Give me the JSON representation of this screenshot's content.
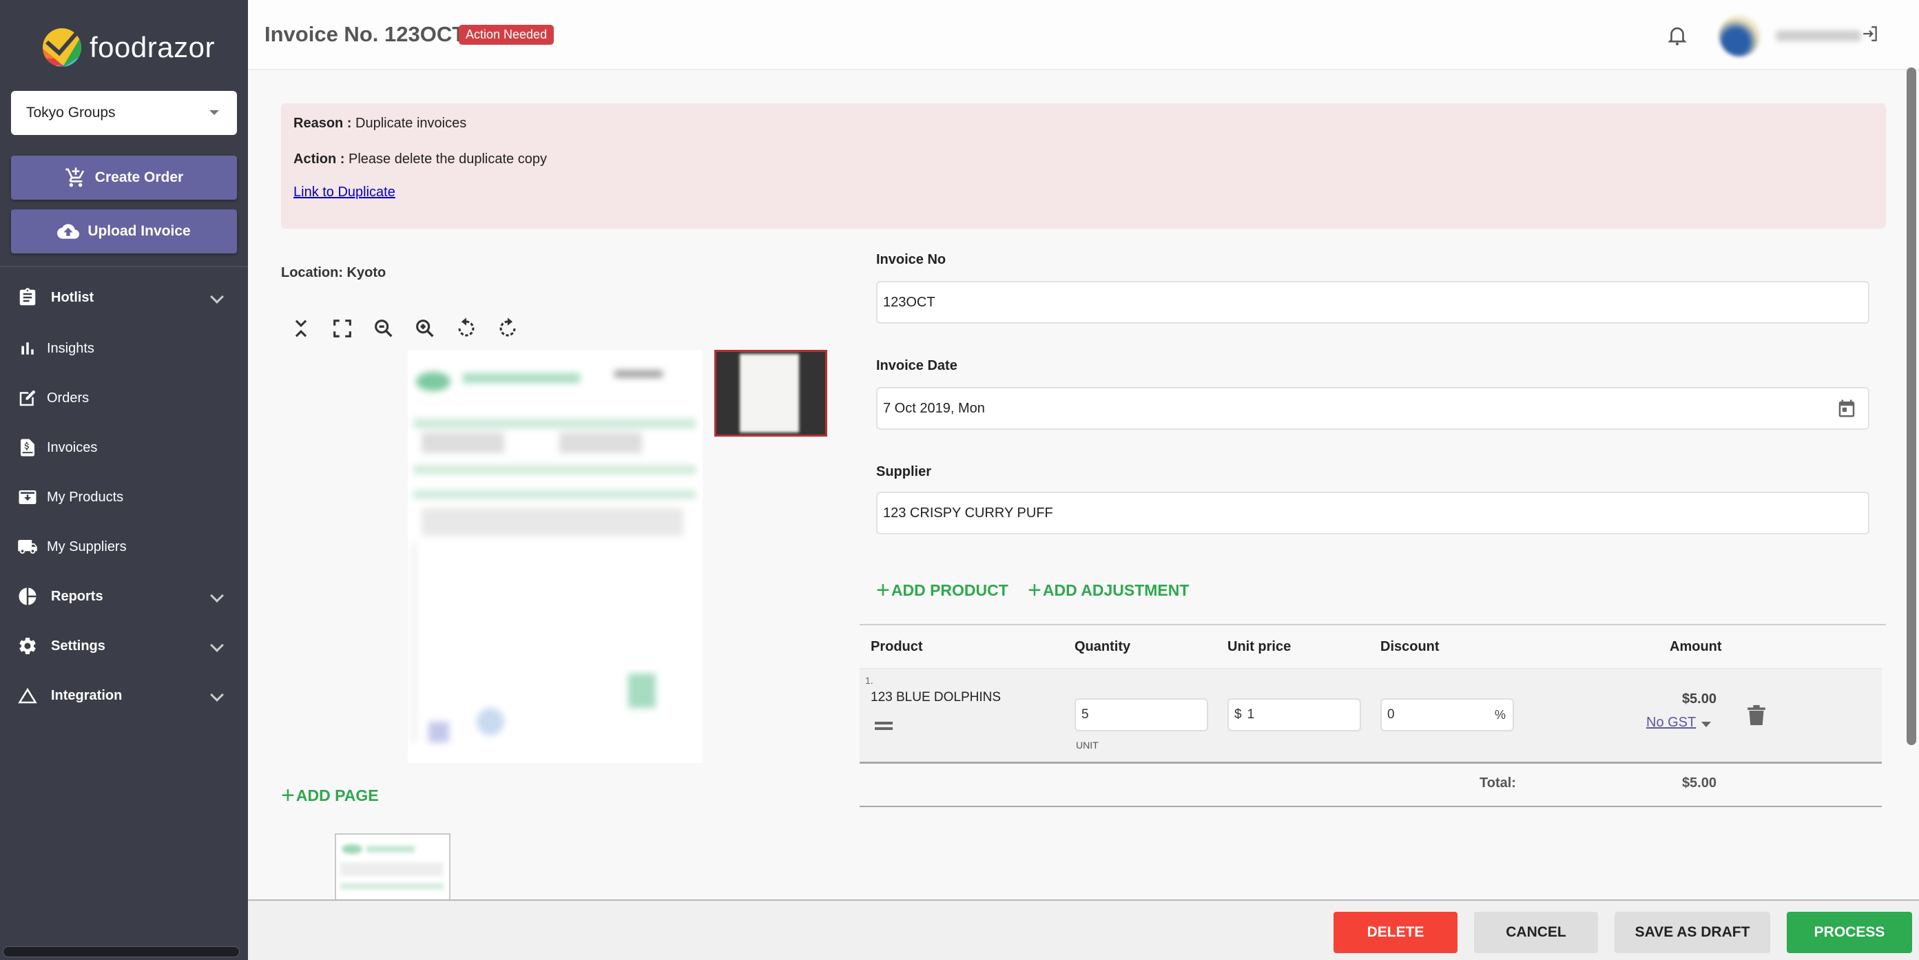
{
  "sidebar": {
    "brand": "foodrazor",
    "org_selector": {
      "value": "Tokyo Groups"
    },
    "buttons": {
      "create_order": "Create Order",
      "upload_invoice": "Upload Invoice"
    },
    "nav": [
      {
        "label": "Hotlist",
        "icon": "clipboard-icon",
        "expandable": true
      },
      {
        "label": "Insights",
        "icon": "bar-chart-icon",
        "expandable": false
      },
      {
        "label": "Orders",
        "icon": "edit-icon",
        "expandable": false
      },
      {
        "label": "Invoices",
        "icon": "invoice-icon",
        "expandable": false
      },
      {
        "label": "My Products",
        "icon": "archive-icon",
        "expandable": false
      },
      {
        "label": "My Suppliers",
        "icon": "truck-icon",
        "expandable": false
      },
      {
        "label": "Reports",
        "icon": "pie-chart-icon",
        "expandable": true
      },
      {
        "label": "Settings",
        "icon": "gear-icon",
        "expandable": true
      },
      {
        "label": "Integration",
        "icon": "triangle-icon",
        "expandable": true
      }
    ]
  },
  "header": {
    "title": "Invoice No. 123OCT",
    "status_badge": "Action Needed",
    "colors": {
      "badge": "#d13f45"
    }
  },
  "alert": {
    "reason_label": "Reason :",
    "reason_text": "Duplicate invoices",
    "action_label": "Action :",
    "action_text": "Please delete the duplicate copy",
    "link": "Link to Duplicate"
  },
  "viewer": {
    "location": "Location: Kyoto",
    "tools": [
      "collapse-icon",
      "fullscreen-icon",
      "zoom-out-icon",
      "zoom-in-icon",
      "rotate-left-icon",
      "rotate-right-icon"
    ],
    "add_page": "ADD PAGE"
  },
  "form": {
    "invoice_no": {
      "label": "Invoice No",
      "value": "123OCT"
    },
    "invoice_date": {
      "label": "Invoice Date",
      "value": "7 Oct 2019, Mon"
    },
    "supplier": {
      "label": "Supplier",
      "value": "123 CRISPY CURRY PUFF"
    },
    "add_product": "ADD PRODUCT",
    "add_adjustment": "ADD ADJUSTMENT"
  },
  "table": {
    "headers": {
      "product": "Product",
      "quantity": "Quantity",
      "unit_price": "Unit price",
      "discount": "Discount",
      "amount": "Amount"
    },
    "rows": [
      {
        "index": "1.",
        "product": "123 BLUE DOLPHINS",
        "quantity": "5",
        "unit": "UNIT",
        "currency": "$",
        "unit_price": "1",
        "discount": "0",
        "discount_unit": "%",
        "amount": "$5.00",
        "tax": "No GST"
      }
    ],
    "total_label": "Total:",
    "total_value": "$5.00"
  },
  "footer": {
    "delete": "DELETE",
    "cancel": "CANCEL",
    "save_draft": "SAVE AS DRAFT",
    "process": "PROCESS",
    "colors": {
      "delete": "#f44336",
      "process": "#2eaa50"
    }
  }
}
